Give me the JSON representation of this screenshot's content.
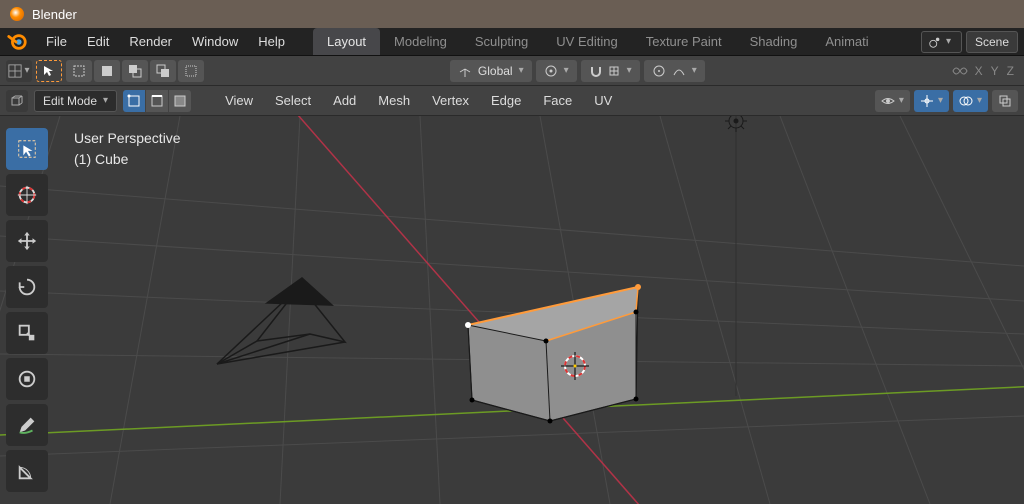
{
  "app": {
    "title": "Blender"
  },
  "menu": {
    "items": [
      "File",
      "Edit",
      "Render",
      "Window",
      "Help"
    ]
  },
  "workspace_tabs": {
    "items": [
      "Layout",
      "Modeling",
      "Sculpting",
      "UV Editing",
      "Texture Paint",
      "Shading",
      "Animati"
    ],
    "active": "Layout"
  },
  "scene": {
    "picker_icon": "scene",
    "name": "Scene"
  },
  "toolbar": {
    "orientation_label": "Global",
    "axis_overlay": [
      "X",
      "Y",
      "Z"
    ]
  },
  "header2": {
    "mode": "Edit Mode",
    "menus": [
      "View",
      "Select",
      "Add",
      "Mesh",
      "Vertex",
      "Edge",
      "Face",
      "UV"
    ],
    "select_mode_active": "vertex"
  },
  "viewport": {
    "info_line1": "User Perspective",
    "info_line2": "(1) Cube"
  },
  "tool_rail": {
    "tools": [
      "select-box",
      "cursor",
      "move",
      "rotate",
      "scale",
      "transform",
      "annotate",
      "measure"
    ],
    "active": "select-box"
  },
  "colors": {
    "axis_x": "#b03347",
    "axis_y": "#6c9b24",
    "select_edge": "#ff9b3b",
    "vertex": "#000000",
    "vertex_selected": "#ffffff",
    "face_fill": "#8f8f8f",
    "wire": "#1a1a1a",
    "accent": "#3a6ea5"
  }
}
